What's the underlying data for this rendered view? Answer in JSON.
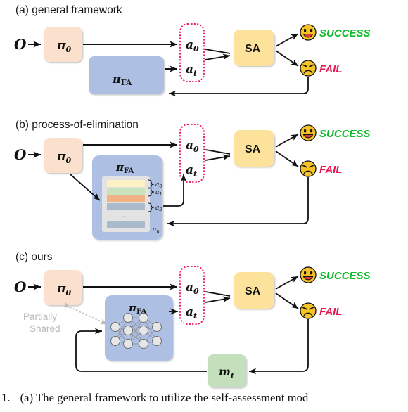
{
  "figure": {
    "caption_number": "1.",
    "caption_text": "(a) The general framework to utilize the self-assessment mod"
  },
  "colors": {
    "policy_box": "#fbe0ce",
    "fa_box": "#adc0e4",
    "sa_box": "#fce29a",
    "memory_box": "#c3dfbc",
    "action_border": "#ee1f6d",
    "success_text": "#12bb2e",
    "fail_text": "#e3174f",
    "face_fill": "#f5c327",
    "shared_text": "#bfbfbf",
    "arrow": "#111111",
    "bar_a0": "#fdf0c4",
    "bar_a1": "#c8e2bb",
    "bar_a2": "#f0b184",
    "bar_a3": "#aabacd",
    "bar_an": "#aabacd",
    "bar_tray": "#e3e3e3"
  },
  "panels": [
    {
      "id": "a",
      "title": "(a) general framework",
      "observation_label": "O",
      "policy_label": "π",
      "policy_sub": "0",
      "fa_label": "π",
      "fa_sub": "FA",
      "actions": [
        "a",
        "a"
      ],
      "action_subs": [
        "0",
        "t"
      ],
      "sa_label": "SA",
      "outcomes": [
        {
          "icon": "smiley-happy-icon",
          "label": "SUCCESS"
        },
        {
          "icon": "smiley-sad-icon",
          "label": "FAIL"
        }
      ]
    },
    {
      "id": "b",
      "title": "(b) process-of-elimination",
      "observation_label": "O",
      "policy_label": "π",
      "policy_sub": "0",
      "fa_label": "π",
      "fa_sub": "FA",
      "candidate_bars": [
        {
          "label": "a",
          "sub": "0"
        },
        {
          "label": "a",
          "sub": "1"
        },
        {
          "label": "a",
          "sub": "2"
        },
        {
          "label": "⋮",
          "sub": ""
        },
        {
          "label": "a",
          "sub": "n"
        }
      ],
      "actions": [
        "a",
        "a"
      ],
      "action_subs": [
        "0",
        "t"
      ],
      "sa_label": "SA",
      "outcomes": [
        {
          "icon": "smiley-happy-icon",
          "label": "SUCCESS"
        },
        {
          "icon": "smiley-sad-icon",
          "label": "FAIL"
        }
      ]
    },
    {
      "id": "c",
      "title": "(c) ours",
      "observation_label": "O",
      "policy_label": "π",
      "policy_sub": "0",
      "fa_label": "π",
      "fa_sub": "FA",
      "shared_note_line1": "Partially",
      "shared_note_line2": "Shared",
      "network_layers": [
        2,
        3,
        3,
        2
      ],
      "memory_label": "m",
      "memory_sub": "t",
      "actions": [
        "a",
        "a"
      ],
      "action_subs": [
        "0",
        "t"
      ],
      "sa_label": "SA",
      "outcomes": [
        {
          "icon": "smiley-happy-icon",
          "label": "SUCCESS"
        },
        {
          "icon": "smiley-sad-icon",
          "label": "FAIL"
        }
      ]
    }
  ]
}
